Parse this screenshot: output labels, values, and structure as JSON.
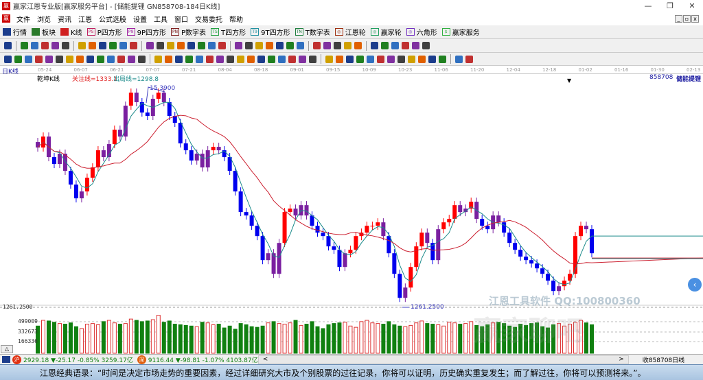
{
  "window": {
    "title": "赢家江恩专业版[赢家服务平台] - [储能提锂  GN858708-184日K线]",
    "minimize": "—",
    "maximize": "❐",
    "close": "✕"
  },
  "menu": [
    "文件",
    "浏览",
    "资讯",
    "江恩",
    "公式选股",
    "设置",
    "工具",
    "窗口",
    "交易委托",
    "帮助"
  ],
  "toolbar": [
    {
      "label": "行情",
      "icon": "table-icon",
      "color": "#1c3d8c"
    },
    {
      "label": "板块",
      "icon": "blocks-icon",
      "color": "#2a7a2a"
    },
    {
      "label": "K线",
      "icon": "kline-icon",
      "color": "#d02020"
    },
    {
      "label": "P四方形",
      "icon": "ps-icon",
      "color": "#c02060",
      "tag": "PS"
    },
    {
      "label": "9P四方形",
      "icon": "p9-icon",
      "color": "#a020a0",
      "tag": "P9"
    },
    {
      "label": "P数字表",
      "icon": "pn-icon",
      "color": "#802020",
      "tag": "PN"
    },
    {
      "label": "T四方形",
      "icon": "ts-icon",
      "color": "#20a040",
      "tag": "TS"
    },
    {
      "label": "9T四方形",
      "icon": "t9-icon",
      "color": "#2090a0",
      "tag": "T9"
    },
    {
      "label": "T数字表",
      "icon": "tn-icon",
      "color": "#208040",
      "tag": "TN"
    },
    {
      "label": "江恩轮",
      "icon": "gann-wheel-icon",
      "color": "#a03010",
      "tag": "◎"
    },
    {
      "label": "赢家轮",
      "icon": "winner-wheel-icon",
      "color": "#20a060",
      "tag": "◎"
    },
    {
      "label": "六角形",
      "icon": "hexagon-icon",
      "color": "#7030c0",
      "tag": "◎"
    },
    {
      "label": "赢家服务",
      "icon": "dollar-icon",
      "color": "#30b040",
      "tag": "$"
    }
  ],
  "date_axis": [
    "05-24",
    "06-07",
    "06-21",
    "07-07",
    "07-21",
    "08-04",
    "08-18",
    "09-01",
    "09-15",
    "10-09",
    "10-23",
    "11-06",
    "11-20",
    "12-04",
    "12-18",
    "01-02",
    "01-16",
    "01-30",
    "02-13"
  ],
  "period_label": "日K线",
  "indicator_name": "乾坤K线",
  "attention_line": "关注线=1333.1",
  "exit_line": "出局线=1298.8",
  "stock_code": "858708",
  "stock_name": "储能提锂",
  "high_label": "15  3900",
  "low_label": "1261.2500",
  "volume_axis": {
    "top": "1261.2500",
    "ticks": [
      "499009",
      "332673",
      "166336"
    ],
    "toggle": "△"
  },
  "watermark": {
    "text": "江恩工具软件  QQ:100800360",
    "big": "赢家聊吧"
  },
  "status": {
    "sh_icon": "沪",
    "sh": "2929.18 ▼-25.17 -0.85% 3259.17亿",
    "sz_icon": "深",
    "sz": "9116.44 ▼-98.81 -1.07% 4103.87亿",
    "scroll_left": "<",
    "scroll_right": ">",
    "right": "收858708日线"
  },
  "quote": "江恩经典语录：“时间是决定市场走势的重要因素，经过详细研究大市及个别股票的过往记录，你将可以证明，历史确实重复发生；而了解过往，你将可以预测将来。”。",
  "colors": {
    "up": "#ff0000",
    "down": "#0000ee",
    "transition": "#7a1fa0",
    "ma_short": "#1a8a8a",
    "ma_long": "#cc2030",
    "vol_up": "#dd3030",
    "vol_down": "#108010"
  },
  "chart_data": {
    "type": "candlestick",
    "price_range": [
      1261.25,
      1581
    ],
    "closes": [
      1494,
      1510,
      1480,
      1470,
      1485,
      1460,
      1440,
      1420,
      1430,
      1450,
      1465,
      1490,
      1480,
      1499,
      1520,
      1510,
      1555,
      1574,
      1560,
      1545,
      1540,
      1565,
      1574,
      1560,
      1540,
      1530,
      1500,
      1490,
      1475,
      1485,
      1465,
      1490,
      1495,
      1490,
      1480,
      1460,
      1430,
      1400,
      1395,
      1380,
      1365,
      1330,
      1340,
      1310,
      1355,
      1400,
      1405,
      1395,
      1410,
      1395,
      1380,
      1370,
      1365,
      1350,
      1345,
      1320,
      1340,
      1345,
      1365,
      1370,
      1380,
      1380,
      1385,
      1365,
      1340,
      1310,
      1275,
      1290,
      1320,
      1350,
      1370,
      1355,
      1330,
      1375,
      1385,
      1390,
      1410,
      1400,
      1405,
      1415,
      1390,
      1380,
      1375,
      1395,
      1385,
      1370,
      1355,
      1345,
      1335,
      1330,
      1325,
      1318,
      1310,
      1300,
      1285,
      1292,
      1300,
      1310,
      1365,
      1380,
      1375,
      1340
    ],
    "volumes": [
      430000,
      520000,
      510000,
      490000,
      470000,
      460000,
      480000,
      420000,
      390000,
      460000,
      470000,
      450000,
      500000,
      520000,
      480000,
      460000,
      470000,
      540000,
      520000,
      500000,
      510000,
      530000,
      600000,
      490000,
      510000,
      460000,
      450000,
      440000,
      430000,
      420000,
      490000,
      480000,
      450000,
      460000,
      400000,
      430000,
      380000,
      470000,
      450000,
      420000,
      410000,
      430000,
      480000,
      500000,
      470000,
      460000,
      480000,
      520000,
      440000,
      460000,
      500000,
      420000,
      390000,
      450000,
      470000,
      480000,
      490000,
      430000,
      410000,
      500000,
      520000,
      480000,
      470000,
      460000,
      500000,
      450000,
      430000,
      420000,
      440000,
      480000,
      510000,
      470000,
      460000,
      450000,
      430000,
      490000,
      480000,
      460000,
      470000,
      500000,
      440000,
      420000,
      450000,
      480000,
      490000,
      470000,
      430000,
      410000,
      460000,
      440000,
      470000,
      480000,
      420000,
      400000,
      450000,
      470000,
      430000,
      460000,
      490000,
      520000,
      480000,
      450000
    ]
  }
}
